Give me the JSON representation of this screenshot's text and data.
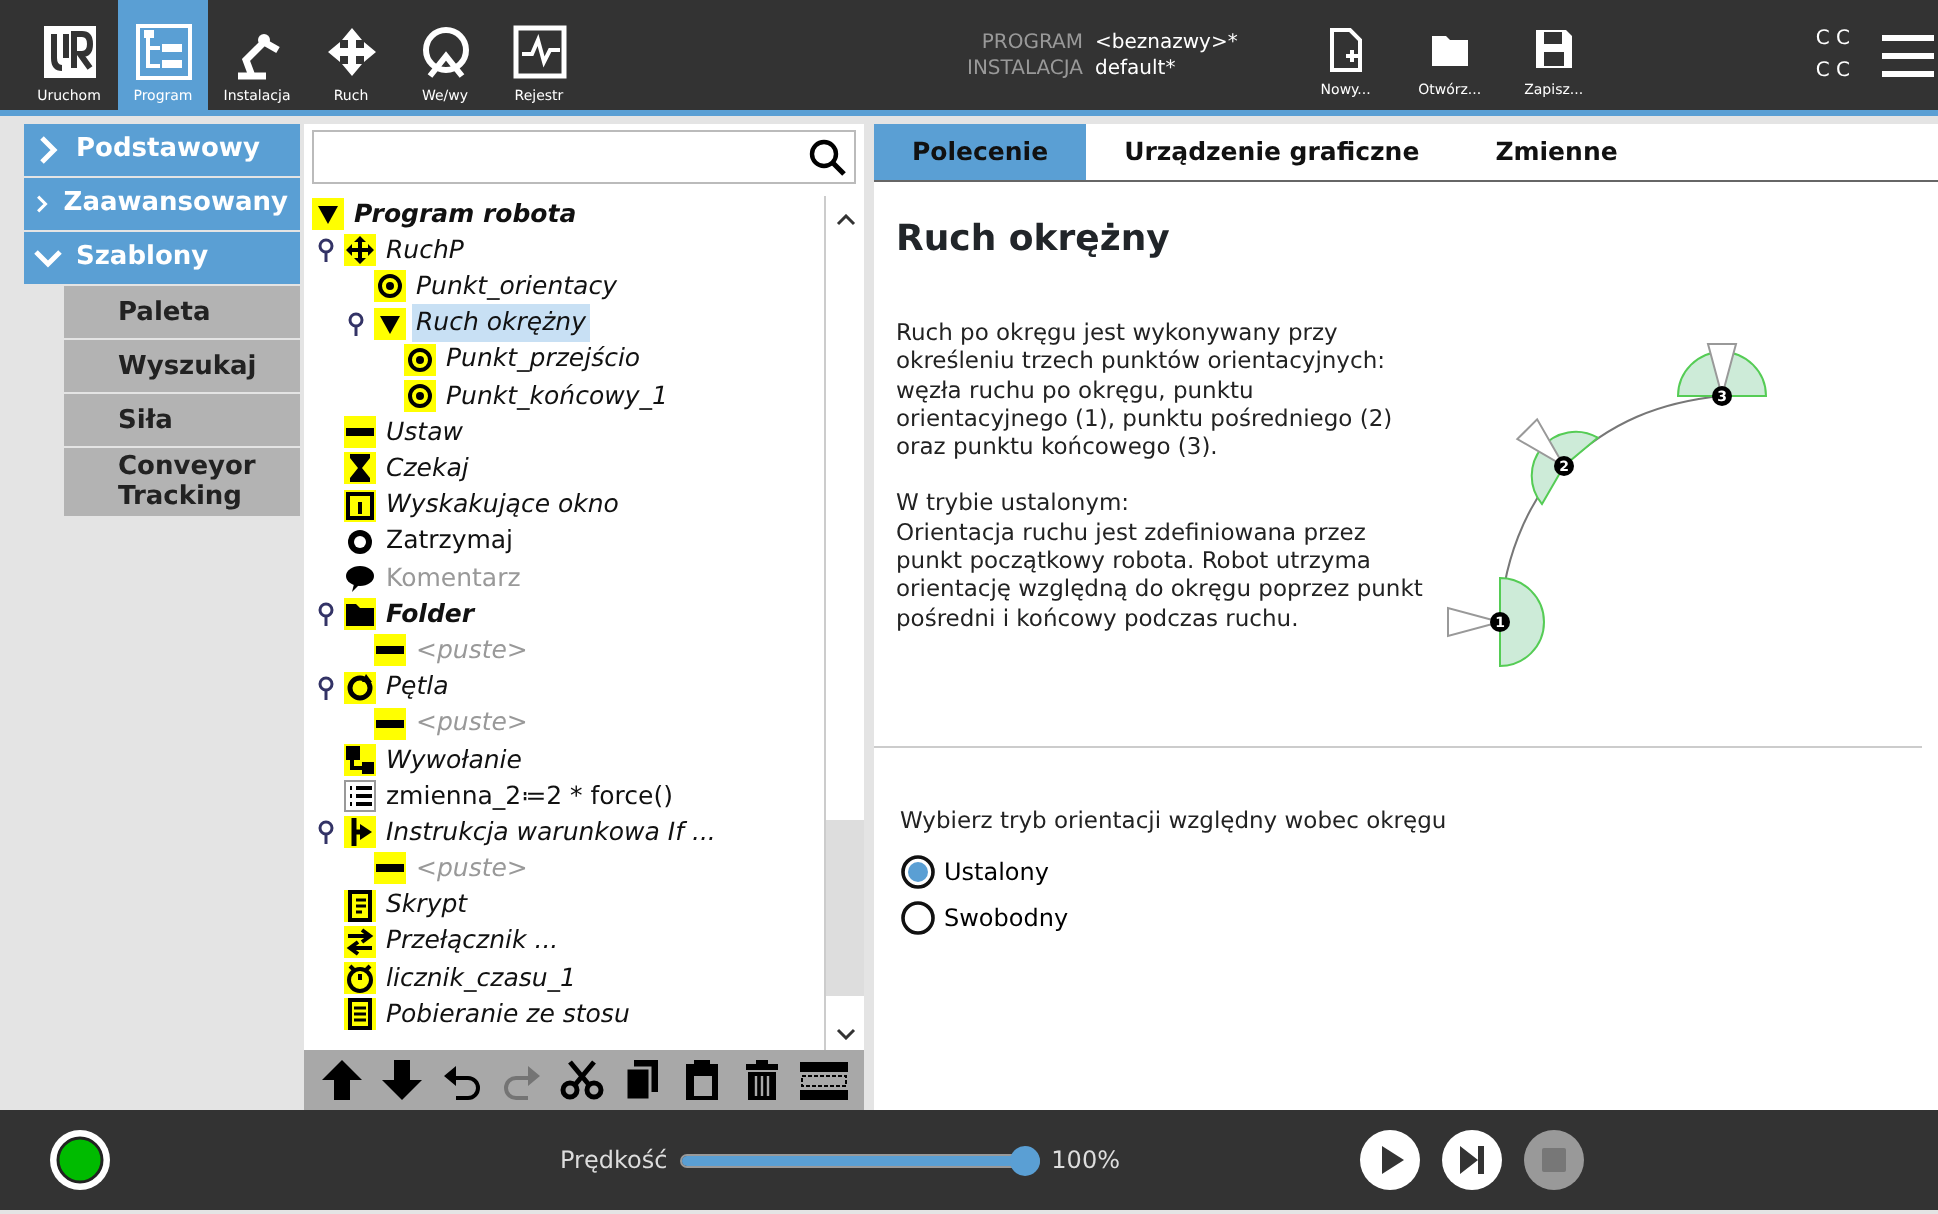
{
  "top_bar": {
    "nav": [
      {
        "label": "Uruchom",
        "selected": false
      },
      {
        "label": "Program",
        "selected": true
      },
      {
        "label": "Instalacja",
        "selected": false
      },
      {
        "label": "Ruch",
        "selected": false
      },
      {
        "label": "We/wy",
        "selected": false
      },
      {
        "label": "Rejestr",
        "selected": false
      }
    ],
    "info": [
      {
        "key": "PROGRAM",
        "value": "<beznazwy>*"
      },
      {
        "key": "INSTALACJA",
        "value": "default*"
      }
    ],
    "file_buttons": [
      "Nowy...",
      "Otwórz...",
      "Zapisz..."
    ],
    "mode_text": [
      "C C",
      "C C"
    ]
  },
  "sidebar": {
    "categories": [
      {
        "label": "Podstawowy",
        "expanded": false
      },
      {
        "label": "Zaawansowany",
        "expanded": false
      },
      {
        "label": "Szablony",
        "expanded": true,
        "children": [
          "Paleta",
          "Wyszukaj",
          "Siła",
          "Conveyor Tracking"
        ]
      }
    ]
  },
  "program_tree": {
    "root": {
      "label": "Program robota",
      "kind": "root",
      "disabled": false,
      "selected": false,
      "children": [
        {
          "label": "RuchP",
          "kind": "move",
          "disabled": false,
          "selected": false,
          "children": [
            {
              "label": "Punkt_orientacy",
              "kind": "waypoint",
              "disabled": false,
              "selected": false
            },
            {
              "label": "Ruch okrężny",
              "kind": "arc",
              "disabled": false,
              "selected": true,
              "children": [
                {
                  "label": "Punkt_przejścio",
                  "kind": "waypoint",
                  "disabled": false,
                  "selected": false
                },
                {
                  "label": "Punkt_końcowy_1",
                  "kind": "waypoint",
                  "disabled": false,
                  "selected": false
                }
              ]
            }
          ]
        },
        {
          "label": "Ustaw",
          "kind": "set",
          "disabled": false,
          "selected": false
        },
        {
          "label": "Czekaj",
          "kind": "wait",
          "disabled": false,
          "selected": false
        },
        {
          "label": "Wyskakujące okno",
          "kind": "popup",
          "disabled": false,
          "selected": false
        },
        {
          "label": "Zatrzymaj",
          "kind": "halt",
          "disabled": false,
          "selected": false
        },
        {
          "label": "Komentarz",
          "kind": "comment",
          "disabled": true,
          "selected": false
        },
        {
          "label": "Folder",
          "kind": "folder",
          "disabled": false,
          "selected": false,
          "children": [
            {
              "label": "<puste>",
              "kind": "empty",
              "disabled": true,
              "selected": false
            }
          ]
        },
        {
          "label": "Pętla",
          "kind": "loop",
          "disabled": false,
          "selected": false,
          "children": [
            {
              "label": "<puste>",
              "kind": "empty",
              "disabled": true,
              "selected": false
            }
          ]
        },
        {
          "label": "Wywołanie",
          "kind": "call",
          "disabled": false,
          "selected": false
        },
        {
          "label": "zmienna_2≔2 * force()",
          "kind": "assign",
          "disabled": false,
          "selected": false
        },
        {
          "label": "Instrukcja warunkowa If ...",
          "kind": "if",
          "disabled": false,
          "selected": false,
          "children": [
            {
              "label": "<puste>",
              "kind": "empty",
              "disabled": true,
              "selected": false
            }
          ]
        },
        {
          "label": "Skrypt",
          "kind": "script",
          "disabled": false,
          "selected": false
        },
        {
          "label": "Przełącznik ...",
          "kind": "switch",
          "disabled": false,
          "selected": false
        },
        {
          "label": "licznik_czasu_1",
          "kind": "timer",
          "disabled": false,
          "selected": false
        },
        {
          "label": "Pobieranie ze stosu",
          "kind": "stack",
          "disabled": false,
          "selected": false
        }
      ]
    }
  },
  "tree_toolbar": [
    {
      "kind": "up",
      "disabled": false
    },
    {
      "kind": "down",
      "disabled": false
    },
    {
      "kind": "undo",
      "disabled": false
    },
    {
      "kind": "redo",
      "disabled": true
    },
    {
      "kind": "cut",
      "disabled": false
    },
    {
      "kind": "copy",
      "disabled": false
    },
    {
      "kind": "paste",
      "disabled": false
    },
    {
      "kind": "delete",
      "disabled": false
    },
    {
      "kind": "suppress",
      "disabled": false
    }
  ],
  "command_panel": {
    "tabs": [
      {
        "label": "Polecenie",
        "selected": true
      },
      {
        "label": "Urządzenie graficzne",
        "selected": false
      },
      {
        "label": "Zmienne",
        "selected": false
      }
    ],
    "title": "Ruch okrężny",
    "description": [
      "Ruch po okręgu jest wykonywany przy określeniu trzech punktów orientacyjnych: węzła ruchu po okręgu, punktu orientacyjnego (1), punktu pośredniego (2) oraz punktu końcowego (3).",
      "W trybie ustalonym:\nOrientacja ruchu jest zdefiniowana przez punkt początkowy robota. Robot utrzyma orientację względną do okręgu poprzez punkt pośredni i końcowy podczas ruchu."
    ],
    "diagram_labels": [
      "1",
      "2",
      "3"
    ],
    "orientation_prompt": "Wybierz tryb orientacji względny wobec okręgu",
    "options": [
      {
        "label": "Ustalony",
        "selected": true
      },
      {
        "label": "Swobodny",
        "selected": false
      }
    ]
  },
  "bottom_bar": {
    "speed_label": "Prędkość",
    "speed": {
      "level": 1.0
    },
    "speed_reading": "100%",
    "controls": [
      {
        "kind": "play",
        "disabled": false
      },
      {
        "kind": "step",
        "disabled": false
      },
      {
        "kind": "stop",
        "disabled": true
      }
    ]
  }
}
